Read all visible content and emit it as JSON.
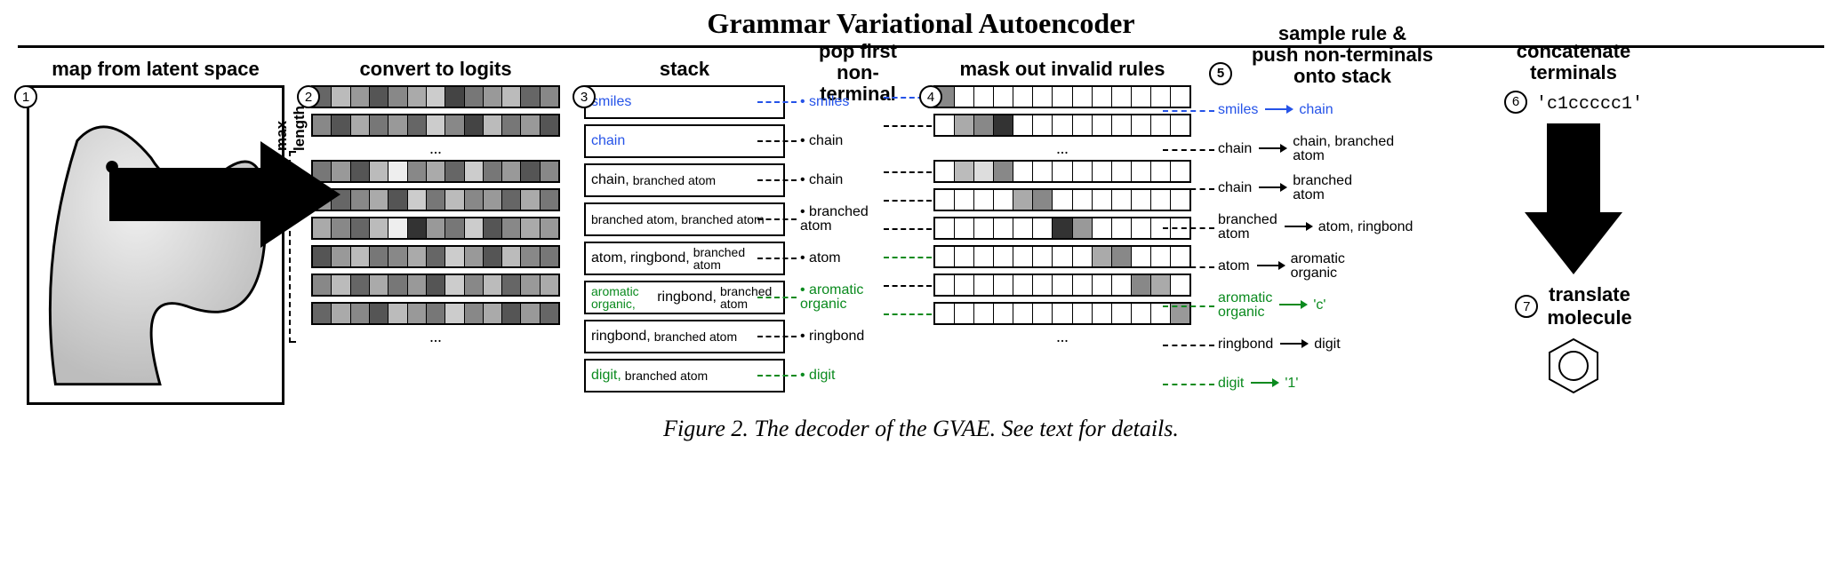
{
  "title": "Grammar Variational Autoencoder",
  "caption_label": "Figure 2.",
  "caption_text": " The decoder of the GVAE. See text for details.",
  "steps": {
    "s1": {
      "num": "1",
      "label": "map from latent space"
    },
    "s2": {
      "num": "2",
      "label": "convert to logits",
      "maxlen": "max length",
      "dots": "..."
    },
    "s3": {
      "num": "3",
      "label": "stack"
    },
    "s4": {
      "label": "pop first\nnon-terminal"
    },
    "s4b": {
      "num": "4",
      "label": "mask out invalid rules",
      "dots": "..."
    },
    "s5": {
      "num": "5",
      "label": "sample rule &\npush non-terminals\nonto stack"
    },
    "s6": {
      "num": "6",
      "label": "concatenate\nterminals",
      "output": "'c1ccccc1'"
    },
    "s7": {
      "num": "7",
      "label": "translate\nmolecule"
    }
  },
  "logit_rows": [
    {
      "shades": [
        "#666",
        "#bbb",
        "#999",
        "#555",
        "#888",
        "#aaa",
        "#ccc",
        "#444",
        "#777",
        "#999",
        "#bbb",
        "#666",
        "#888"
      ]
    },
    {
      "shades": [
        "#888",
        "#555",
        "#aaa",
        "#777",
        "#999",
        "#666",
        "#ccc",
        "#888",
        "#444",
        "#bbb",
        "#777",
        "#999",
        "#555"
      ]
    },
    {
      "dots": true
    },
    {
      "shades": [
        "#777",
        "#999",
        "#555",
        "#bbb",
        "#eee",
        "#888",
        "#aaa",
        "#666",
        "#ccc",
        "#777",
        "#999",
        "#555",
        "#888"
      ]
    },
    {
      "shades": [
        "#999",
        "#666",
        "#888",
        "#aaa",
        "#555",
        "#ccc",
        "#777",
        "#bbb",
        "#888",
        "#999",
        "#666",
        "#aaa",
        "#777"
      ]
    },
    {
      "shades": [
        "#aaa",
        "#888",
        "#666",
        "#bbb",
        "#eee",
        "#333",
        "#999",
        "#777",
        "#ccc",
        "#555",
        "#888",
        "#aaa",
        "#999"
      ]
    },
    {
      "shades": [
        "#555",
        "#999",
        "#bbb",
        "#777",
        "#888",
        "#aaa",
        "#666",
        "#ccc",
        "#999",
        "#555",
        "#bbb",
        "#888",
        "#777"
      ]
    },
    {
      "shades": [
        "#888",
        "#bbb",
        "#666",
        "#aaa",
        "#777",
        "#999",
        "#555",
        "#ccc",
        "#888",
        "#bbb",
        "#666",
        "#999",
        "#aaa"
      ]
    },
    {
      "shades": [
        "#666",
        "#aaa",
        "#888",
        "#555",
        "#bbb",
        "#999",
        "#777",
        "#ccc",
        "#888",
        "#aaa",
        "#555",
        "#999",
        "#666"
      ]
    },
    {
      "dots": true
    }
  ],
  "stack_rows": [
    {
      "segs": [
        {
          "t": "smiles",
          "c": "fg-blue"
        }
      ]
    },
    {
      "segs": [
        {
          "t": "chain",
          "c": "fg-blue"
        }
      ]
    },
    {
      "segs": [
        {
          "t": "chain,"
        },
        {
          "t": "branched atom",
          "sm": true
        }
      ]
    },
    {
      "segs": [
        {
          "t": "branched atom,",
          "sm": true
        },
        {
          "t": "branched atom",
          "sm": true
        }
      ]
    },
    {
      "segs": [
        {
          "t": "atom,"
        },
        {
          "t": "ringbond,"
        },
        {
          "t": "branched atom",
          "sm": true
        }
      ]
    },
    {
      "segs": [
        {
          "t": "aromatic organic,",
          "c": "fg-green",
          "sm": true
        },
        {
          "t": "ringbond,"
        },
        {
          "t": "branched atom",
          "sm": true
        }
      ]
    },
    {
      "segs": [
        {
          "t": "ringbond,"
        },
        {
          "t": "branched atom",
          "sm": true
        }
      ]
    },
    {
      "segs": [
        {
          "t": "digit,",
          "c": "fg-green"
        },
        {
          "t": "branched atom",
          "sm": true
        }
      ]
    }
  ],
  "popped": [
    {
      "t": "smiles",
      "c": "fg-blue"
    },
    {
      "t": "chain"
    },
    {
      "t": "chain"
    },
    {
      "t": "branched\natom"
    },
    {
      "t": "atom"
    },
    {
      "t": "aromatic\norganic",
      "c": "fg-green"
    },
    {
      "t": "ringbond"
    },
    {
      "t": "digit",
      "c": "fg-green"
    }
  ],
  "mask_rows": [
    {
      "cells": [
        "#888",
        "#fff",
        "#fff",
        "#fff",
        "#fff",
        "#fff",
        "#fff",
        "#fff",
        "#fff",
        "#fff",
        "#fff",
        "#fff",
        "#fff"
      ],
      "c": "c-blue"
    },
    {
      "cells": [
        "#fff",
        "#aaa",
        "#888",
        "#333",
        "#fff",
        "#fff",
        "#fff",
        "#fff",
        "#fff",
        "#fff",
        "#fff",
        "#fff",
        "#fff"
      ]
    },
    {
      "dots": true
    },
    {
      "cells": [
        "#fff",
        "#bbb",
        "#ddd",
        "#888",
        "#fff",
        "#fff",
        "#fff",
        "#fff",
        "#fff",
        "#fff",
        "#fff",
        "#fff",
        "#fff"
      ]
    },
    {
      "cells": [
        "#fff",
        "#fff",
        "#fff",
        "#fff",
        "#aaa",
        "#888",
        "#fff",
        "#fff",
        "#fff",
        "#fff",
        "#fff",
        "#fff",
        "#fff"
      ]
    },
    {
      "cells": [
        "#fff",
        "#fff",
        "#fff",
        "#fff",
        "#fff",
        "#fff",
        "#333",
        "#999",
        "#fff",
        "#fff",
        "#fff",
        "#fff",
        "#fff"
      ]
    },
    {
      "cells": [
        "#fff",
        "#fff",
        "#fff",
        "#fff",
        "#fff",
        "#fff",
        "#fff",
        "#fff",
        "#aaa",
        "#888",
        "#fff",
        "#fff",
        "#fff"
      ],
      "c": "c-green"
    },
    {
      "cells": [
        "#fff",
        "#fff",
        "#fff",
        "#fff",
        "#fff",
        "#fff",
        "#fff",
        "#fff",
        "#fff",
        "#fff",
        "#888",
        "#aaa",
        "#fff"
      ]
    },
    {
      "cells": [
        "#fff",
        "#fff",
        "#fff",
        "#fff",
        "#fff",
        "#fff",
        "#fff",
        "#fff",
        "#fff",
        "#fff",
        "#fff",
        "#fff",
        "#999"
      ],
      "c": "c-green"
    },
    {
      "dots": true
    }
  ],
  "sample_rules": [
    {
      "lhs": "smiles",
      "rhs": "chain",
      "c": "c-blue",
      "lc": "fg-blue",
      "rc": "fg-blue"
    },
    {
      "lhs": "chain",
      "rhs": "chain, branched\natom"
    },
    {
      "lhs": "chain",
      "rhs": "branched\natom"
    },
    {
      "lhs": "branched\natom",
      "rhs": "atom, ringbond"
    },
    {
      "lhs": "atom",
      "rhs": "aromatic\norganic"
    },
    {
      "lhs": "aromatic\norganic",
      "rhs": "'c'",
      "c": "c-green",
      "lc": "fg-green",
      "rc": "fg-green"
    },
    {
      "lhs": "ringbond",
      "rhs": "digit"
    },
    {
      "lhs": "digit",
      "rhs": "'1'",
      "c": "c-green",
      "lc": "fg-green",
      "rc": "fg-green"
    }
  ]
}
